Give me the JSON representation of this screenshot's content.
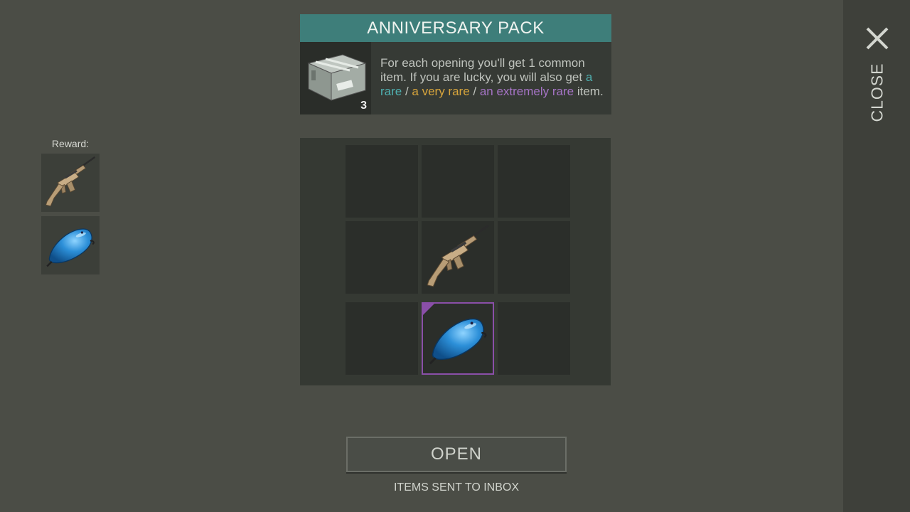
{
  "pack": {
    "title": "ANNIVERSARY PACK",
    "count": "3",
    "desc_common": "For each opening you'll get 1 common item. If you are lucky, you will also get ",
    "rare": "a rare",
    "sep1": " / ",
    "very_rare": "a very rare",
    "sep2": " / ",
    "extremely_rare": "an extremely rare",
    "desc_end": " item."
  },
  "reward": {
    "label": "Reward:",
    "items": [
      {
        "icon": "rifle-icon"
      },
      {
        "icon": "blue-gas-tank-icon"
      }
    ]
  },
  "grid": {
    "slots": [
      {
        "item": null
      },
      {
        "item": null
      },
      {
        "item": null
      },
      {
        "item": null
      },
      {
        "item": "rifle-icon"
      },
      {
        "item": null
      },
      {
        "item": null
      },
      {
        "item": "blue-gas-tank-icon",
        "rarity": "extremely rare"
      },
      {
        "item": null
      }
    ]
  },
  "actions": {
    "open_label": "OPEN",
    "inbox_text": "ITEMS SENT TO INBOX",
    "close_label": "CLOSE"
  },
  "colors": {
    "header": "#3e7e7a",
    "rare": "#4fb0b0",
    "very_rare": "#d8a53c",
    "extremely_rare": "#a674c6"
  }
}
